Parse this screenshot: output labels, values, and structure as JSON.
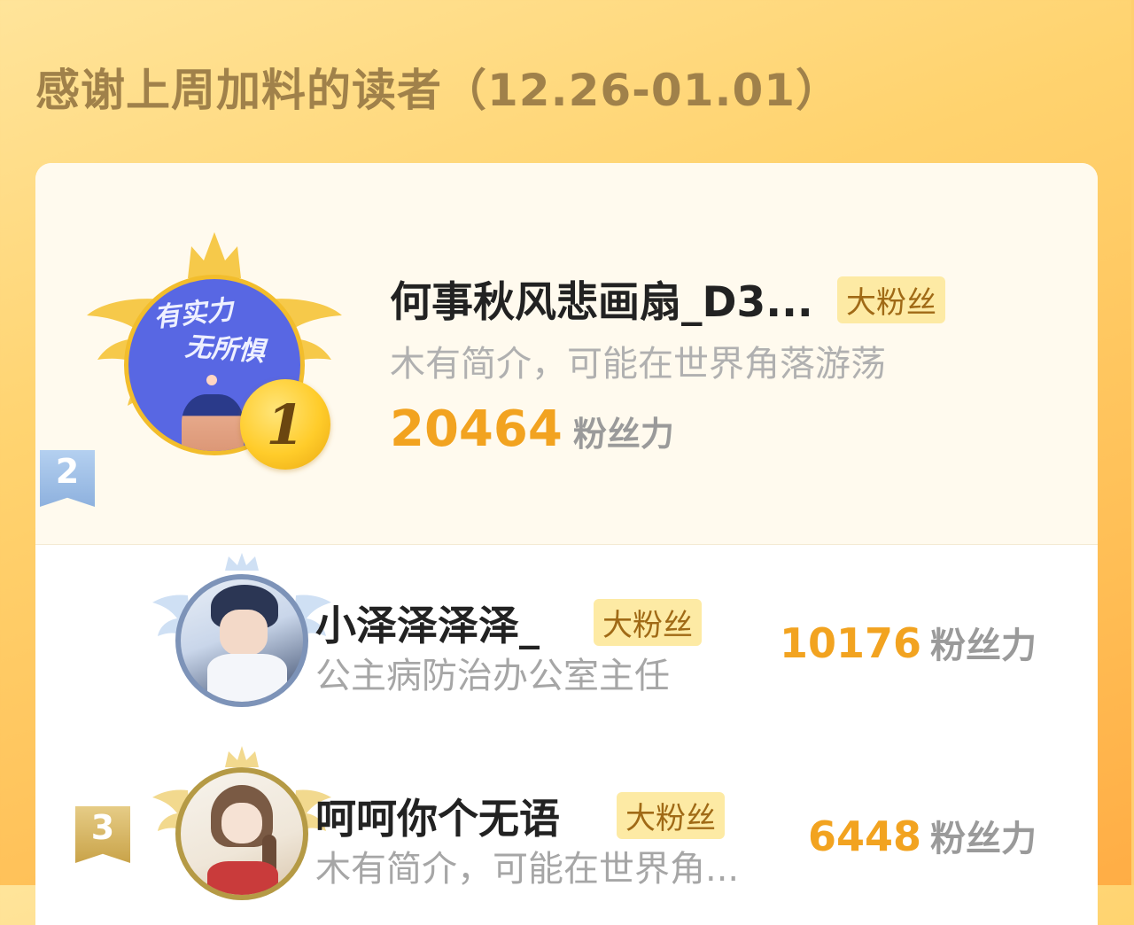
{
  "header": {
    "title": "感谢上周加料的读者（12.26-01.01）"
  },
  "top_reader": {
    "rank": "1",
    "name": "何事秋风悲画扇_D3...",
    "badge": "大粉丝",
    "bio": "木有简介，可能在世界角落游荡",
    "score": "20464",
    "score_unit": "粉丝力",
    "avatar_text": [
      "有实力",
      "无所惧"
    ]
  },
  "readers": [
    {
      "rank": "2",
      "name": "小泽泽泽泽_",
      "badge": "大粉丝",
      "bio": "公主病防治办公室主任",
      "score": "10176",
      "score_unit": "粉丝力"
    },
    {
      "rank": "3",
      "name": "呵呵你个无语",
      "badge": "大粉丝",
      "bio": "木有简介，可能在世界角...",
      "score": "6448",
      "score_unit": "粉丝力"
    }
  ],
  "colors": {
    "accent": "#f2a320",
    "badge_bg": "#fdeaa4",
    "title": "#a0814a",
    "gold": "#f2bd2c"
  },
  "icons": {
    "rank1": "crown-wings-icon",
    "rank2": "silver-ribbon-icon",
    "rank3": "bronze-ribbon-icon"
  }
}
